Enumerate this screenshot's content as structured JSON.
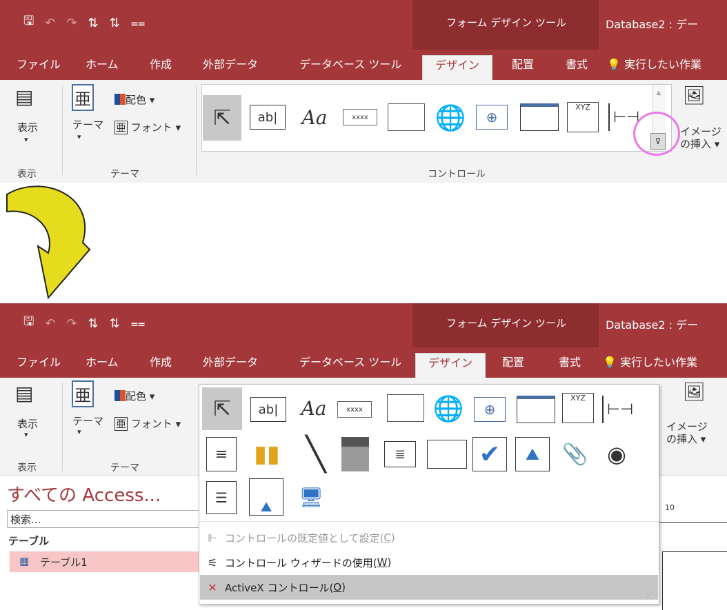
{
  "titlebar": {
    "qat_save": "🖫",
    "qat_undo": "↶",
    "qat_redo": "↷",
    "qat_sort1": "⇅",
    "qat_sort2": "⇅",
    "qat_more": "⩵",
    "context_title": "フォーム デザイン ツール",
    "db_title": "Database2 : デー"
  },
  "tabs": [
    "ファイル",
    "ホーム",
    "作成",
    "外部データ",
    "データベース ツール",
    "デザイン",
    "配置",
    "書式"
  ],
  "tell_me": "実行したい作業",
  "ribbon": {
    "view_label": "表示",
    "view_group": "表示",
    "theme_label": "テーマ",
    "colors_label": "配色",
    "fonts_label": "フォント",
    "theme_group": "テーマ",
    "controls_group": "コントロール",
    "image_insert_1": "イメージ",
    "image_insert_2": "の挿入",
    "dropdown_arrow": "▾"
  },
  "gallery": {
    "textbox": "ab|",
    "label": "Aa",
    "button": "xxxx",
    "chart_xyz": "XYZ"
  },
  "nav": {
    "title": "すべての Access...",
    "search_placeholder": "検索...",
    "section": "テーブル",
    "item": "テーブル1"
  },
  "ruler": {
    "ten": "10"
  },
  "menu": {
    "set_default": "コントロールの既定値として設定(",
    "set_default_key": "C",
    "use_wizard": "コントロール ウィザードの使用(",
    "use_wizard_key": "W",
    "activex": "ActiveX コントロール(",
    "activex_key": "O",
    "close_paren": ")"
  },
  "colors": {
    "title_red": "#a4373a",
    "context_red": "#8e2d2f",
    "ribbon_gray": "#f3f3f3",
    "highlight_pink": "#ea79ea",
    "arrow_yellow": "#e6dc1e"
  }
}
